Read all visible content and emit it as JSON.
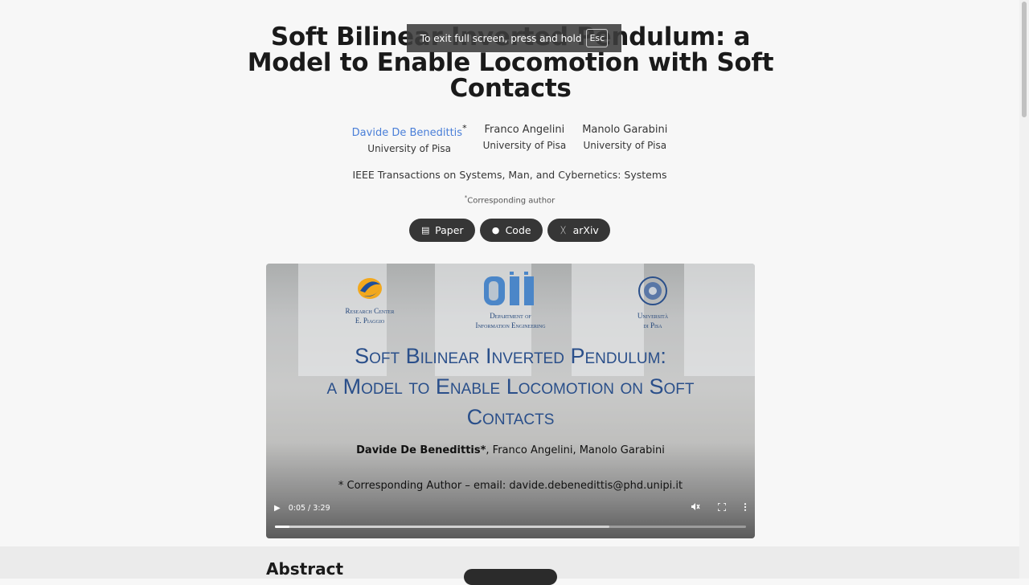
{
  "paper": {
    "title": "Soft Bilinear Inverted Pendulum: a Model to Enable Locomotion with Soft Contacts",
    "authors": [
      {
        "name": "Davide De Benedittis",
        "mark": "*",
        "affiliation": "University of Pisa"
      },
      {
        "name": "Franco Angelini",
        "mark": "",
        "affiliation": "University of Pisa"
      },
      {
        "name": "Manolo Garabini",
        "mark": "",
        "affiliation": "University of Pisa"
      }
    ],
    "venue": "IEEE Transactions on Systems, Man, and Cybernetics: Systems",
    "corresponding_mark": "*",
    "corresponding_note": "Corresponding author",
    "links": [
      {
        "label": "Paper",
        "icon": "pdf-icon",
        "glyph": "▤"
      },
      {
        "label": "Code",
        "icon": "github-icon",
        "glyph": "●"
      },
      {
        "label": "arXiv",
        "icon": "arxiv-icon",
        "glyph": "ᚷ"
      }
    ]
  },
  "video": {
    "logos": [
      {
        "icon": "piaggio-logo-icon",
        "line1": "Research Center",
        "line2": "E. Piaggio"
      },
      {
        "icon": "dii-logo-icon",
        "line1": "Department of",
        "line2": "Information Engineering"
      },
      {
        "icon": "unipi-seal-icon",
        "line1": "Università",
        "line2": "di Pisa"
      }
    ],
    "title_line1": "Soft Bilinear Inverted Pendulum:",
    "title_line2": "a Model to Enable Locomotion on Soft",
    "title_line3": "Contacts",
    "authors_bold": "Davide De Benedittis*",
    "authors_rest": ", Franco Angelini, Manolo Garabini",
    "corresponding": "* Corresponding Author – email: davide.debenedittis@phd.unipi.it",
    "time": "0:05 / 3:29",
    "progress_played": 0.03,
    "progress_buffered": 0.71,
    "muted": true
  },
  "section": {
    "abstract_heading": "Abstract"
  },
  "fullscreen_toast": {
    "text": "To exit full screen, press and hold",
    "key": "Esc"
  }
}
